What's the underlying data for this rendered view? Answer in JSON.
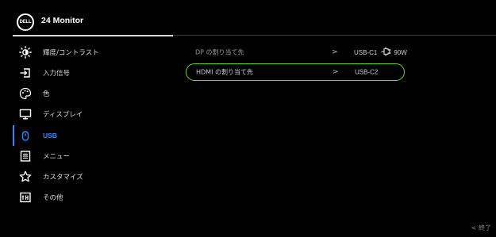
{
  "header": {
    "logo_text": "DELL",
    "title": "24 Monitor"
  },
  "sidebar": {
    "items": [
      {
        "label": "輝度/コントラスト",
        "icon": "brightness-icon"
      },
      {
        "label": "入力信号",
        "icon": "input-source-icon"
      },
      {
        "label": "色",
        "icon": "color-palette-icon"
      },
      {
        "label": "ディスプレイ",
        "icon": "display-icon"
      },
      {
        "label": "USB",
        "icon": "usb-power-icon",
        "active": true
      },
      {
        "label": "メニュー",
        "icon": "menu-icon"
      },
      {
        "label": "カスタマイズ",
        "icon": "star-icon"
      },
      {
        "label": "その他",
        "icon": "others-icon"
      }
    ]
  },
  "main": {
    "rows": [
      {
        "label": "DP の割り当て先",
        "chevron": ">",
        "value_port": "USB-C1",
        "value_power": "90W"
      },
      {
        "label": "HDMI の割り当て先",
        "chevron": ">",
        "value_port": "USB-C2",
        "selected": true
      }
    ]
  },
  "footer": {
    "exit_label": "< 終了"
  },
  "colors": {
    "accent_blue": "#2d8cff",
    "selection_green": "#6fcf3a",
    "background": "#000000"
  }
}
